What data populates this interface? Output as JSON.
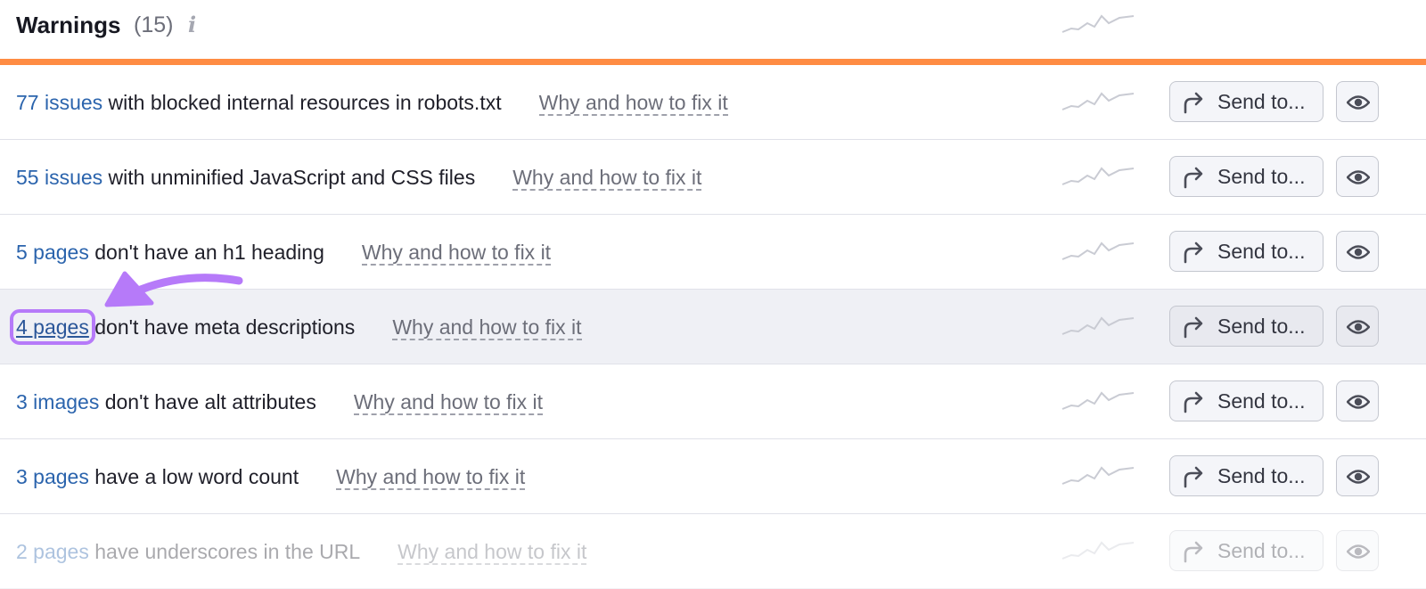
{
  "header": {
    "title": "Warnings",
    "count": "(15)",
    "info_icon": "i"
  },
  "colors": {
    "accent_bar": "#ff8c43",
    "link": "#2b64ad",
    "annotation": "#b67af9",
    "highlight_row": "#eff0f5"
  },
  "fix_label": "Why and how to fix it",
  "send_label": "Send to...",
  "icons": {
    "send": "share-arrow-icon",
    "eye": "eye-icon",
    "trend": "sparkline-icon",
    "info": "info-icon",
    "annotation": "curved-arrow-icon"
  },
  "rows": [
    {
      "link": "77 issues",
      "text": " with blocked internal resources in robots.txt"
    },
    {
      "link": "55 issues",
      "text": " with unminified JavaScript and CSS files"
    },
    {
      "link": "5 pages",
      "text": " don't have an h1 heading"
    },
    {
      "link": "4 pages",
      "text": " don't have meta descriptions"
    },
    {
      "link": "3 images",
      "text": " don't have alt attributes"
    },
    {
      "link": "3 pages",
      "text": " have a low word count"
    },
    {
      "link": "2 pages",
      "text": " have underscores in the URL"
    }
  ]
}
